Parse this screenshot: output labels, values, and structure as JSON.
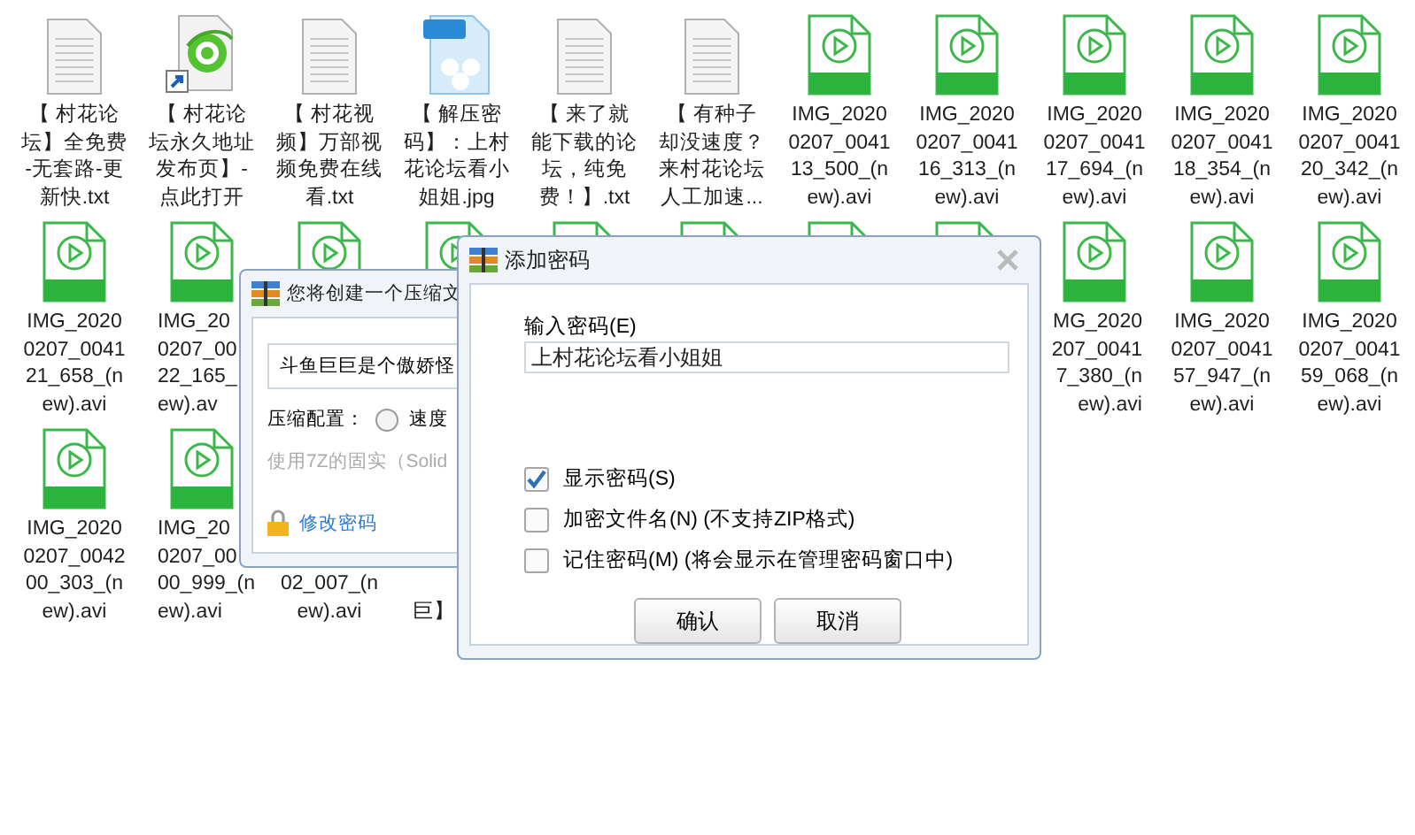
{
  "desktop": {
    "files": [
      {
        "kind": "txt",
        "cut_left": false,
        "cut_right": false,
        "lines": [
          "【 村花论",
          "坛】全免费",
          "-无套路-更",
          "新快.txt"
        ]
      },
      {
        "kind": "shortcut",
        "cut_left": false,
        "cut_right": false,
        "lines": [
          "【 村花论",
          "坛永久地址",
          "发布页】-",
          "点此打开"
        ]
      },
      {
        "kind": "txt",
        "cut_left": false,
        "cut_right": false,
        "lines": [
          "【 村花视",
          "频】万部视",
          "频免费在线",
          "看.txt"
        ]
      },
      {
        "kind": "jpg",
        "cut_left": false,
        "cut_right": false,
        "lines": [
          "【 解压密",
          "码】：上村",
          "花论坛看小",
          "姐姐.jpg"
        ]
      },
      {
        "kind": "txt",
        "cut_left": false,
        "cut_right": false,
        "lines": [
          "【 来了就",
          "能下载的论",
          "坛，纯免",
          "费！】.txt"
        ]
      },
      {
        "kind": "txt",
        "cut_left": false,
        "cut_right": false,
        "lines": [
          "【 有种子",
          "却没速度？",
          "来村花论坛",
          "人工加速..."
        ]
      },
      {
        "kind": "avi",
        "cut_left": false,
        "cut_right": false,
        "lines": [
          "IMG_2020",
          "0207_0041",
          "13_500_(n",
          "ew).avi"
        ]
      },
      {
        "kind": "avi",
        "cut_left": false,
        "cut_right": false,
        "lines": [
          "IMG_2020",
          "0207_0041",
          "16_313_(n",
          "ew).avi"
        ]
      },
      {
        "kind": "avi",
        "cut_left": false,
        "cut_right": false,
        "lines": [
          "IMG_2020",
          "0207_0041",
          "17_694_(n",
          "ew).avi"
        ]
      },
      {
        "kind": "avi",
        "cut_left": false,
        "cut_right": false,
        "lines": [
          "IMG_2020",
          "0207_0041",
          "18_354_(n",
          "ew).avi"
        ]
      },
      {
        "kind": "avi",
        "cut_left": false,
        "cut_right": false,
        "lines": [
          "IMG_2020",
          "0207_0041",
          "20_342_(n",
          "ew).avi"
        ]
      },
      {
        "kind": "avi",
        "cut_left": false,
        "cut_right": false,
        "lines": [
          "IMG_2020",
          "0207_0041",
          "21_658_(n",
          "ew).avi"
        ]
      },
      {
        "kind": "avi",
        "cut_left": false,
        "cut_right": true,
        "lines": [
          "IMG_20",
          "0207_00",
          "22_165_",
          "ew).av"
        ]
      },
      {
        "kind": "avi"
      },
      {
        "kind": "avi"
      },
      {
        "kind": "avi"
      },
      {
        "kind": "avi"
      },
      {
        "kind": "avi"
      },
      {
        "kind": "avi"
      },
      {
        "kind": "avi",
        "cut_left": true,
        "cut_right": false,
        "lines": [
          "MG_2020",
          "207_0041",
          "7_380_(n",
          "ew).avi"
        ]
      },
      {
        "kind": "avi",
        "cut_left": false,
        "cut_right": false,
        "lines": [
          "IMG_2020",
          "0207_0041",
          "57_947_(n",
          "ew).avi"
        ]
      },
      {
        "kind": "avi",
        "cut_left": false,
        "cut_right": false,
        "lines": [
          "IMG_2020",
          "0207_0041",
          "59_068_(n",
          "ew).avi"
        ]
      },
      {
        "kind": "avi",
        "cut_left": false,
        "cut_right": false,
        "lines": [
          "IMG_2020",
          "0207_0042",
          "00_303_(n",
          "ew).avi"
        ]
      },
      {
        "kind": "avi",
        "cut_left": false,
        "cut_right": true,
        "lines": [
          "IMG_20",
          "0207_00",
          "00_999_(n",
          "ew).avi"
        ]
      },
      {
        "kind": "hidden",
        "cut_left": false,
        "cut_right": false,
        "lines": [
          "02_007_(n",
          "ew).avi"
        ]
      },
      {
        "kind": "hidden",
        "cut_left": false,
        "cut_right": true,
        "lines": [
          "巨】"
        ]
      }
    ]
  },
  "compress_dialog": {
    "title": "您将创建一个压缩文",
    "archive_name": "斗鱼巨巨是个傲娇怪",
    "config_label": "压缩配置：",
    "radio": {
      "label": "速度",
      "selected": false
    },
    "solid_note": "使用7Z的固实（Solid",
    "change_password_link": "修改密码"
  },
  "password_dialog": {
    "title": "添加密码",
    "password_label": "输入密码(E)",
    "password_value": "上村花论坛看小姐姐",
    "options": [
      {
        "label": "显示密码(S)",
        "checked": true
      },
      {
        "label": "加密文件名(N) (不支持ZIP格式)",
        "checked": false
      },
      {
        "label": "记住密码(M) (将会显示在管理密码窗口中)",
        "checked": false
      }
    ],
    "buttons": [
      "确认",
      "取消"
    ]
  }
}
